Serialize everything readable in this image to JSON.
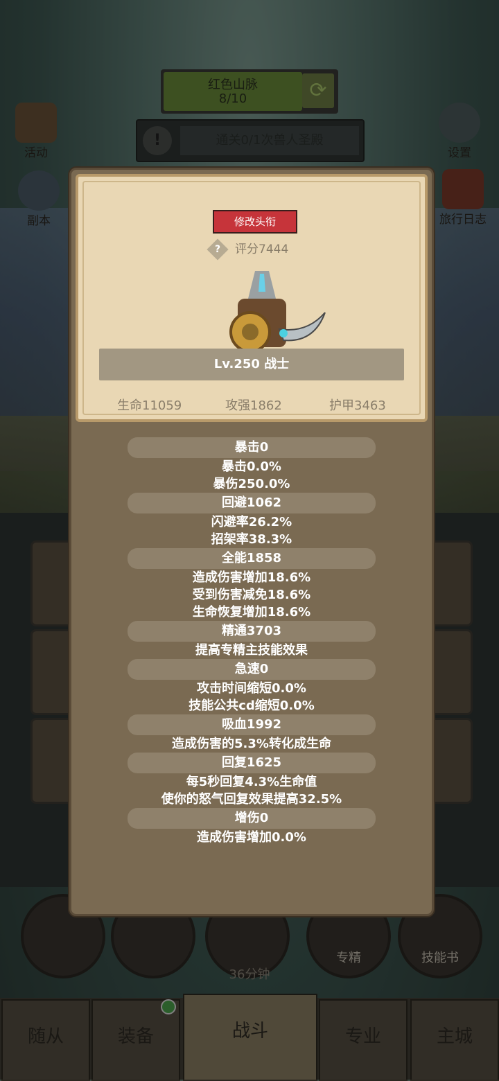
{
  "top": {
    "region_name": "红色山脉",
    "region_progress": "8/10",
    "quest_text": "通关0/1次兽人圣殿"
  },
  "side_icons": {
    "activity": "活动",
    "dungeon": "副本",
    "settings": "设置",
    "travel_log": "旅行日志"
  },
  "bottom_buttons": {
    "specialization": "专精",
    "skill_book": "技能书",
    "timer": "36分钟"
  },
  "tabs": [
    "随从",
    "装备",
    "战斗",
    "专业",
    "主城"
  ],
  "popup": {
    "change_title_label": "修改头衔",
    "score_icon": "?",
    "score": "评分7444",
    "level_class": "Lv.250 战士",
    "hp": "生命11059",
    "attack": "攻强1862",
    "armor": "护甲3463",
    "sections": [
      {
        "header": "暴击0",
        "lines": [
          "暴击0.0%",
          "暴伤250.0%"
        ]
      },
      {
        "header": "回避1062",
        "lines": [
          "闪避率26.2%",
          "招架率38.3%"
        ]
      },
      {
        "header": "全能1858",
        "lines": [
          "造成伤害增加18.6%",
          "受到伤害减免18.6%",
          "生命恢复增加18.6%"
        ]
      },
      {
        "header": "精通3703",
        "lines": [
          "提高专精主技能效果"
        ]
      },
      {
        "header": "急速0",
        "lines": [
          "攻击时间缩短0.0%",
          "技能公共cd缩短0.0%"
        ]
      },
      {
        "header": "吸血1992",
        "lines": [
          "造成伤害的5.3%转化成生命"
        ]
      },
      {
        "header": "回复1625",
        "lines": [
          "每5秒回复4.3%生命值",
          "使你的怒气回复效果提高32.5%"
        ]
      },
      {
        "header": "增伤0",
        "lines": [
          "造成伤害增加0.0%"
        ]
      }
    ]
  },
  "colors": {
    "title_button": "#c6343a",
    "parchment": "#e9d7b4",
    "popup_body": "#7a6a52"
  }
}
